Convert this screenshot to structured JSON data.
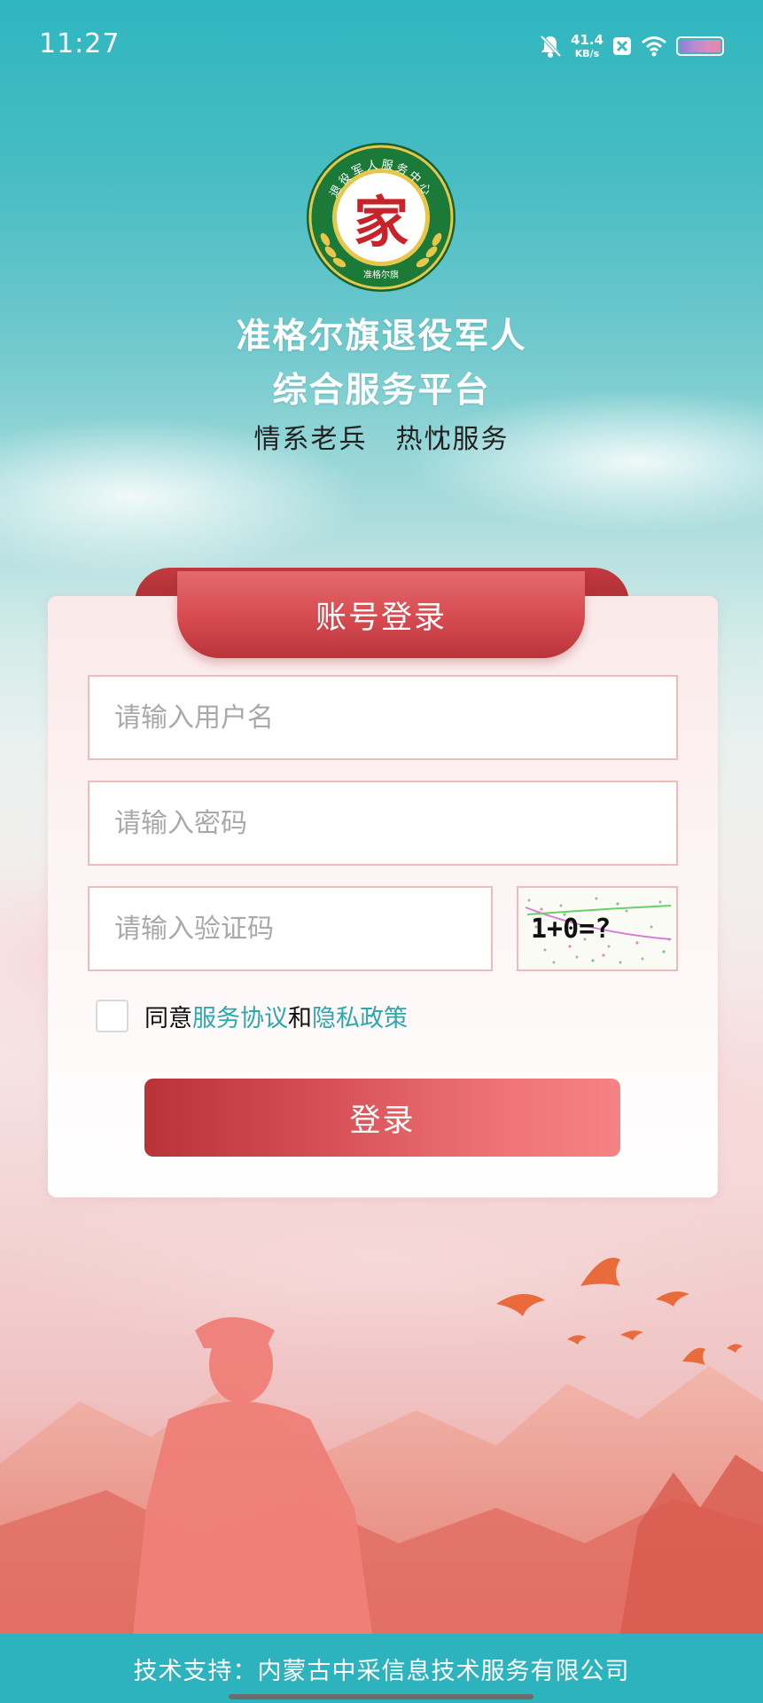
{
  "status_bar": {
    "time": "11:27",
    "speed_value": "41.4",
    "speed_unit": "KB/s",
    "icons": [
      "bell-muted-icon",
      "close-box-icon",
      "wifi-icon",
      "battery-icon"
    ]
  },
  "header": {
    "logo_ring_text": "退役军人服务中心",
    "logo_bottom_text": "准格尔旗",
    "logo_center_char": "家",
    "title_line1": "准格尔旗退役军人",
    "title_line2": "综合服务平台",
    "slogan": "情系老兵　热忱服务"
  },
  "login_card": {
    "title": "账号登录",
    "username_placeholder": "请输入用户名",
    "password_placeholder": "请输入密码",
    "captcha_placeholder": "请输入验证码",
    "captcha_text": "1+0=?",
    "agree_prefix": "同意",
    "service_agreement": "服务协议",
    "agree_and": "和",
    "privacy_policy": "隐私政策",
    "login_button": "登录"
  },
  "footer": {
    "text": "技术支持：内蒙古中采信息技术服务有限公司"
  },
  "colors": {
    "teal": "#2db3bd",
    "red": "#d64a4f",
    "link": "#2ea7ad"
  }
}
